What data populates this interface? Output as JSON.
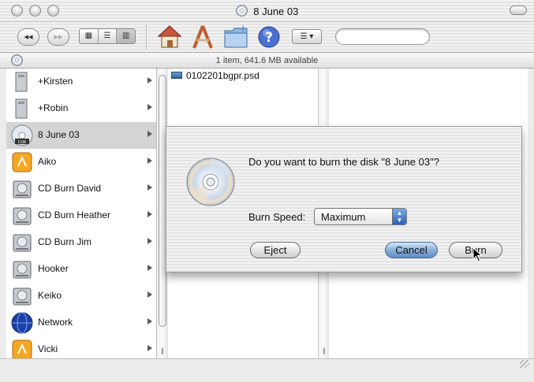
{
  "window": {
    "title": "8 June 03"
  },
  "toolbar": {
    "back_icon": "back-arrow-icon",
    "forward_icon": "forward-arrow-icon",
    "view_icons": [
      "icon-view-icon",
      "list-view-icon",
      "column-view-icon"
    ],
    "shortcut_icons": [
      "home-icon",
      "applications-icon",
      "folder-icon",
      "help-icon"
    ],
    "action_icon": "action-menu-icon",
    "search_placeholder": ""
  },
  "status": {
    "text": "1 item, 641.6 MB available"
  },
  "sidebar": {
    "items": [
      {
        "label": "+Kirsten",
        "icon": "server-icon"
      },
      {
        "label": "+Robin",
        "icon": "server-icon"
      },
      {
        "label": "8 June 03",
        "icon": "cdr-disc-icon",
        "selected": true
      },
      {
        "label": "Aiko",
        "icon": "firewire-drive-icon"
      },
      {
        "label": "CD Burn David",
        "icon": "hard-drive-icon"
      },
      {
        "label": "CD Burn Heather",
        "icon": "hard-drive-icon"
      },
      {
        "label": "CD Burn Jim",
        "icon": "hard-drive-icon"
      },
      {
        "label": "Hooker",
        "icon": "hard-drive-icon"
      },
      {
        "label": "Keiko",
        "icon": "hard-drive-icon"
      },
      {
        "label": "Network",
        "icon": "network-globe-icon"
      },
      {
        "label": "Vicki",
        "icon": "firewire-drive-icon"
      }
    ]
  },
  "files": [
    {
      "name": "0102201bgpr.psd",
      "icon": "psd-file-icon"
    }
  ],
  "dialog": {
    "prompt": "Do you want to burn the disk \"8 June 03\"?",
    "speed_label": "Burn Speed:",
    "speed_value": "Maximum",
    "eject_label": "Eject",
    "cancel_label": "Cancel",
    "burn_label": "Burn"
  },
  "colors": {
    "selection": "#d4d4d4",
    "default_button": "#8fb4dd",
    "popup_arrows": "#2a62bd"
  }
}
